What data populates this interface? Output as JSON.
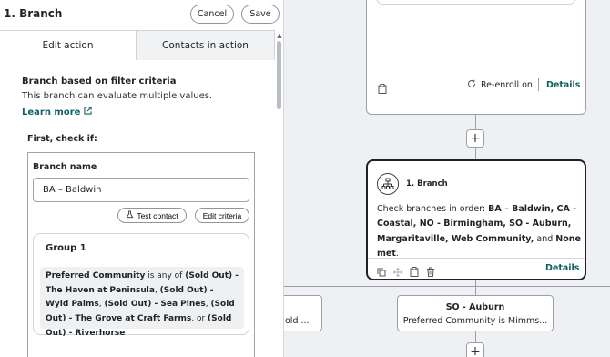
{
  "panel": {
    "title": "1. Branch",
    "cancel_label": "Cancel",
    "save_label": "Save",
    "tabs": [
      {
        "label": "Edit action",
        "active": true
      },
      {
        "label": "Contacts in action",
        "active": false
      }
    ],
    "heading": "Branch based on filter criteria",
    "description": "This branch can evaluate multiple values.",
    "learn_more": "Learn more",
    "first_check": "First, check if:",
    "branch_name_label": "Branch name",
    "branch_name_value": "BA – Baldwin",
    "test_contact_label": "Test contact",
    "edit_criteria_label": "Edit criteria",
    "group": {
      "title": "Group 1",
      "field": "Preferred Community",
      "operator": "is any of",
      "values": [
        "(Sold Out) - The Haven at Peninsula",
        "(Sold Out) - Wyld Palms",
        "(Sold Out) - Sea Pines",
        "(Sold Out) - The Grove at Craft Farms"
      ],
      "connector": "or",
      "last_value": "(Sold Out) - Riverhorse"
    }
  },
  "canvas": {
    "top_card": {
      "reenroll_label": "Re-enroll on",
      "details_label": "Details"
    },
    "branch_card": {
      "title": "1. Branch",
      "text_prefix": "Check branches in order:",
      "branches_line": "BA – Baldwin, CA - Coastal, NO - Birmingham, SO - Auburn, Margaritaville, Web Community,",
      "connector": "and",
      "last": "None met",
      "details_label": "Details"
    },
    "left_card_text": "old ...",
    "so_card": {
      "name": "SO - Auburn",
      "desc": "Preferred Community is Mimms..."
    },
    "plus": "+"
  },
  "colors": {
    "accent": "#0f5f63",
    "border": "#9aa0a6",
    "canvas_bg": "#eef0f3"
  }
}
